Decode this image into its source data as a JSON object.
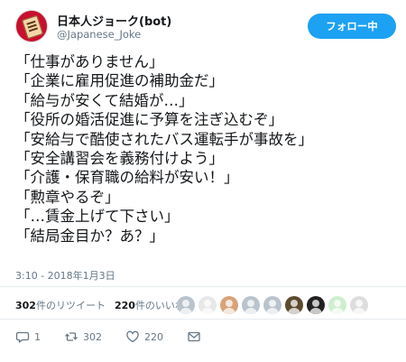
{
  "account": {
    "name": "日本人ジョーク(bot)",
    "handle": "@Japanese_Joke"
  },
  "follow_button": {
    "label": "フォロー中"
  },
  "tweet": {
    "lines": [
      "「仕事がありません」",
      "「企業に雇用促進の補助金だ」",
      "「給与が安くて結婚が…」",
      "「役所の婚活促進に予算を注ぎ込むぞ」",
      "「安給与で酷使されたバス運転手が事故を」",
      "「安全講習会を義務付けよう」",
      "「介護・保育職の給料が安い！」",
      "「勲章やるぞ」",
      "「…賃金上げて下さい」",
      "「結局金目か？あ？」"
    ],
    "timestamp": "3:10 - 2018年1月3日"
  },
  "stats": {
    "retweets_num": "302",
    "retweets_label": "件のリツイート",
    "likes_num": "220",
    "likes_label": "件のいいね"
  },
  "actions": {
    "reply_count": "1",
    "retweet_count": "302",
    "like_count": "220"
  },
  "icons": {
    "reply": "reply-icon",
    "retweet": "retweet-icon",
    "like": "heart-icon",
    "dm": "envelope-icon"
  },
  "colors": {
    "accent": "#1da1f2",
    "text": "#14171a",
    "muted": "#657786"
  }
}
